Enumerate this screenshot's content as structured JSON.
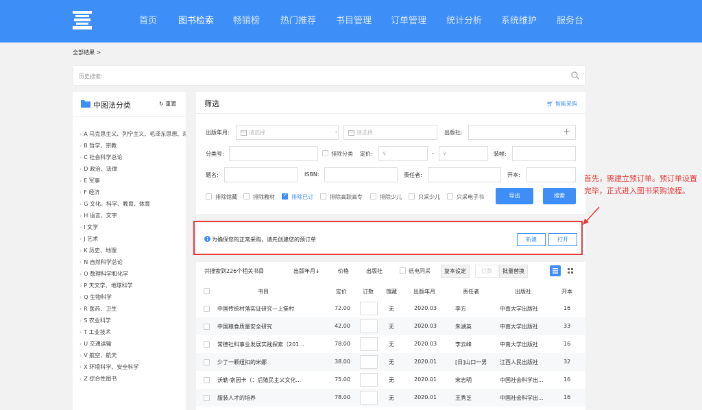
{
  "nav": {
    "items": [
      "首页",
      "图书检索",
      "畅销榜",
      "热门推荐",
      "书目管理",
      "订单管理",
      "统计分析",
      "系统维护",
      "服务台"
    ],
    "active_index": 1,
    "color": "#3e8ef7"
  },
  "breadcrumb": "全部结果 >",
  "history": {
    "placeholder": "历史搜索:"
  },
  "category": {
    "title": "中图法分类",
    "reset": "重置",
    "items": [
      "A 马克思主义、列宁主义、毛泽东思想、邓小平理论",
      "B 哲学、宗教",
      "C 社会科学总论",
      "D 政治、法律",
      "E 军事",
      "F 经济",
      "G 文化、科学、教育、体育",
      "H 语言、文字",
      "I 文学",
      "J 艺术",
      "K 历史、地理",
      "N 自然科学总论",
      "O 数理科学和化学",
      "P 天文学、地球科学",
      "Q 生物科学",
      "R 医药、卫生",
      "S 农业科学",
      "T 工业技术",
      "U 交通运输",
      "V 航空、航天",
      "X 环境科学、安全科学",
      "Z 综合性图书"
    ]
  },
  "filter": {
    "title": "筛选",
    "smart_purchase": "智能采购",
    "pub_date_label": "出版年月:",
    "date_placeholder": "请选择",
    "dash": "-",
    "publisher_label": "出版社:",
    "class_label": "分类号:",
    "exclude_class": "排除分类",
    "price_label": "定价:",
    "price_placeholder": "¥",
    "binding_label": "装帧:",
    "title_label": "题名:",
    "isbn_label": "ISBN:",
    "author_label": "责任者:",
    "format_label": "开本:",
    "checkboxes": [
      {
        "label": "排除馆藏",
        "checked": false
      },
      {
        "label": "排除教材",
        "checked": false
      },
      {
        "label": "排除已订",
        "checked": true
      },
      {
        "label": "排除高职高专",
        "checked": false
      },
      {
        "label": "排除少儿",
        "checked": false
      },
      {
        "label": "只采少儿",
        "checked": false
      },
      {
        "label": "只采电子书",
        "checked": false
      }
    ],
    "export": "导出",
    "search": "搜索"
  },
  "notice": {
    "text": "为确保您的正常采购，请先创建您的预订单",
    "new": "新建",
    "open": "打开"
  },
  "annotation": "首先，需建立预订单。预订单设置完毕，正式进入图书采购流程。",
  "results": {
    "summary": "共搜索到226个相关书目",
    "sort_date": "出版年月↓",
    "sort_price": "价格",
    "sort_publisher": "出版社",
    "paper_elec": "纸电同采",
    "copy_setting": "复本设定",
    "qty_btn": "订数",
    "batch_replace": "批量替换",
    "headers": {
      "title": "书目",
      "price": "定价",
      "qty": "订数",
      "held": "馆藏",
      "date": "出版年月",
      "author": "责任者",
      "publisher": "出版社",
      "format": "开本"
    },
    "rows": [
      {
        "title": "中国传统村落实证研究—上堡村",
        "price": "72.00",
        "held": "无",
        "date": "2020.03",
        "author": "李方",
        "publisher": "中南大学出版社",
        "format": "16"
      },
      {
        "title": "中国粮食质量安全研究",
        "price": "42.00",
        "held": "无",
        "date": "2020.03",
        "author": "朱湖英",
        "publisher": "中南大学出版社",
        "format": "33"
      },
      {
        "title": "常德社科事业发展实践探索（201...",
        "price": "78.00",
        "held": "无",
        "date": "2020.03",
        "author": "李云峰",
        "publisher": "中南大学出版社",
        "format": "16"
      },
      {
        "title": "少了一颗纽扣的米娜",
        "price": "38.00",
        "held": "无",
        "date": "2020.01",
        "author": "[日]山口一男",
        "publisher": "江西人民出版社",
        "format": "32"
      },
      {
        "title": "沃勒·索因卡（：后殖民主义文化...",
        "price": "75.00",
        "held": "无",
        "date": "2020.01",
        "author": "宋志明",
        "publisher": "中国社会科学出...",
        "format": "16"
      },
      {
        "title": "服装人才的培养",
        "price": "78.00",
        "held": "无",
        "date": "2020.01",
        "author": "王秀芝",
        "publisher": "中国社会科学出...",
        "format": "16"
      }
    ]
  }
}
